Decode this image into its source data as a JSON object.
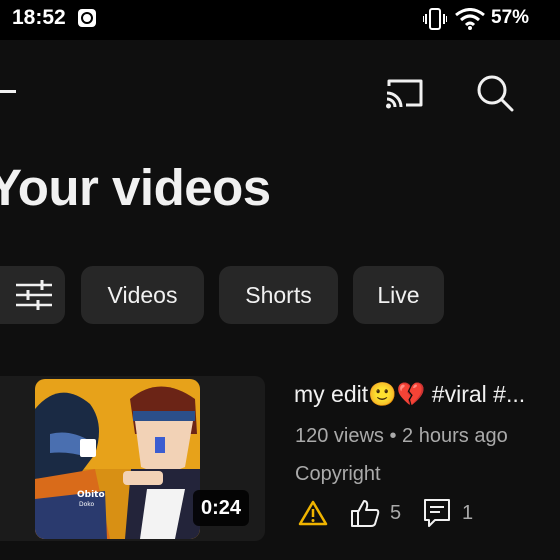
{
  "status_bar": {
    "time": "18:52",
    "battery": "57%"
  },
  "page": {
    "title": "Your videos"
  },
  "filters": {
    "videos": "Videos",
    "shorts": "Shorts",
    "live": "Live"
  },
  "video": {
    "title": "my edit🙂💔 #viral #...",
    "meta": "120 views • 2 hours ago",
    "status": "Copyright",
    "duration": "0:24",
    "likes": "5",
    "comments": "1",
    "thumbnail_caption": "Obito",
    "thumbnail_subcaption": "Doko"
  },
  "colors": {
    "background": "#0f0f0f",
    "chip": "#272727",
    "warning": "#f0b400",
    "secondary_text": "#aaaaaa"
  },
  "icons": [
    "back-arrow-icon",
    "cast-icon",
    "search-icon",
    "filter-sliders-icon",
    "warning-icon",
    "like-icon",
    "comment-icon"
  ]
}
